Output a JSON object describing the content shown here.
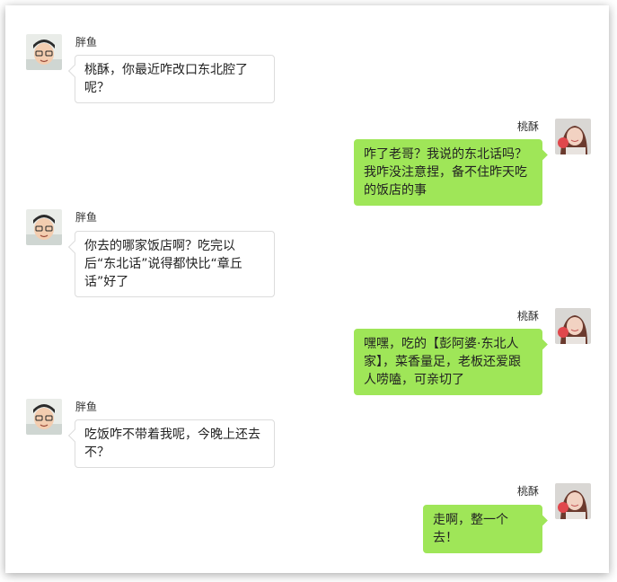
{
  "contacts": {
    "left_name": "胖鱼",
    "right_name": "桃酥"
  },
  "messages": [
    {
      "side": "left",
      "sender": "胖鱼",
      "text": "桃酥，你最近咋改口东北腔了呢？"
    },
    {
      "side": "right",
      "sender": "桃酥",
      "text": "咋了老哥？我说的东北话吗？我咋没注意捏，备不住昨天吃的饭店的事"
    },
    {
      "side": "left",
      "sender": "胖鱼",
      "text": "你去的哪家饭店啊？吃完以后“东北话”说得都快比“章丘话”好了"
    },
    {
      "side": "right",
      "sender": "桃酥",
      "text": "嘿嘿，吃的【彭阿婆·东北人家】，菜香量足，老板还爱跟人唠嗑，可亲切了"
    },
    {
      "side": "left",
      "sender": "胖鱼",
      "text": "吃饭咋不带着我呢，今晚上还去不？"
    },
    {
      "side": "right",
      "sender": "桃酥",
      "text": "走啊，整一个去！"
    }
  ]
}
